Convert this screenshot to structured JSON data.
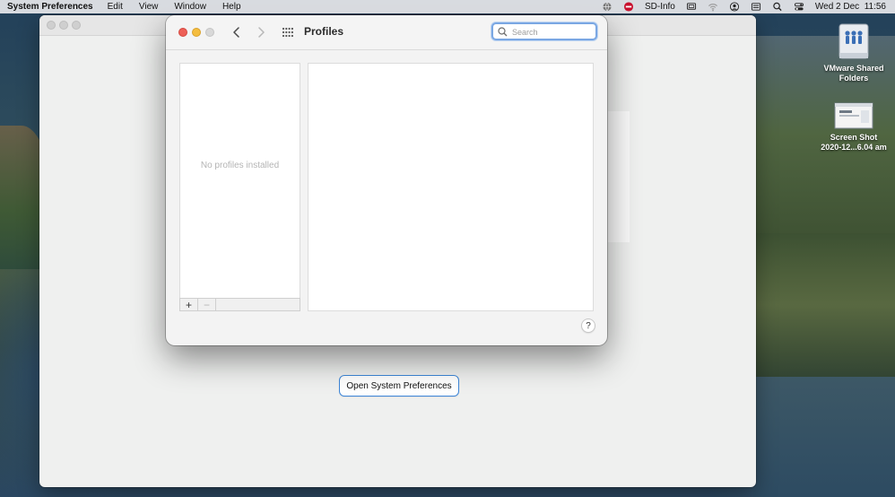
{
  "menubar": {
    "app_name": "System Preferences",
    "menus": [
      "Edit",
      "View",
      "Window",
      "Help"
    ],
    "sd_info": "SD-Info",
    "clock": "Wed 2 Dec  11:56",
    "status_icons": [
      "globe-icon",
      "no-entry-icon",
      "screen-mirroring-icon",
      "wifi-icon",
      "user-icon",
      "keyboard-icon",
      "spotlight-icon",
      "control-center-icon"
    ]
  },
  "profiles_window": {
    "title": "Profiles",
    "search_placeholder": "Search",
    "search_value": "",
    "empty_text": "No profiles installed",
    "add_label": "+",
    "remove_label": "−",
    "help_label": "?"
  },
  "back_window": {
    "open_button_label": "Open System Preferences"
  },
  "desktop": {
    "icons": [
      {
        "line1": "VMware Shared",
        "line2": "Folders"
      },
      {
        "line1": "Screen Shot",
        "line2": "2020-12...6.04 am"
      }
    ]
  },
  "colors": {
    "close": "#ed5f57",
    "minimize": "#f4bd3f",
    "focus_ring": "#7aa7e3",
    "button_border": "#3d86d8"
  }
}
